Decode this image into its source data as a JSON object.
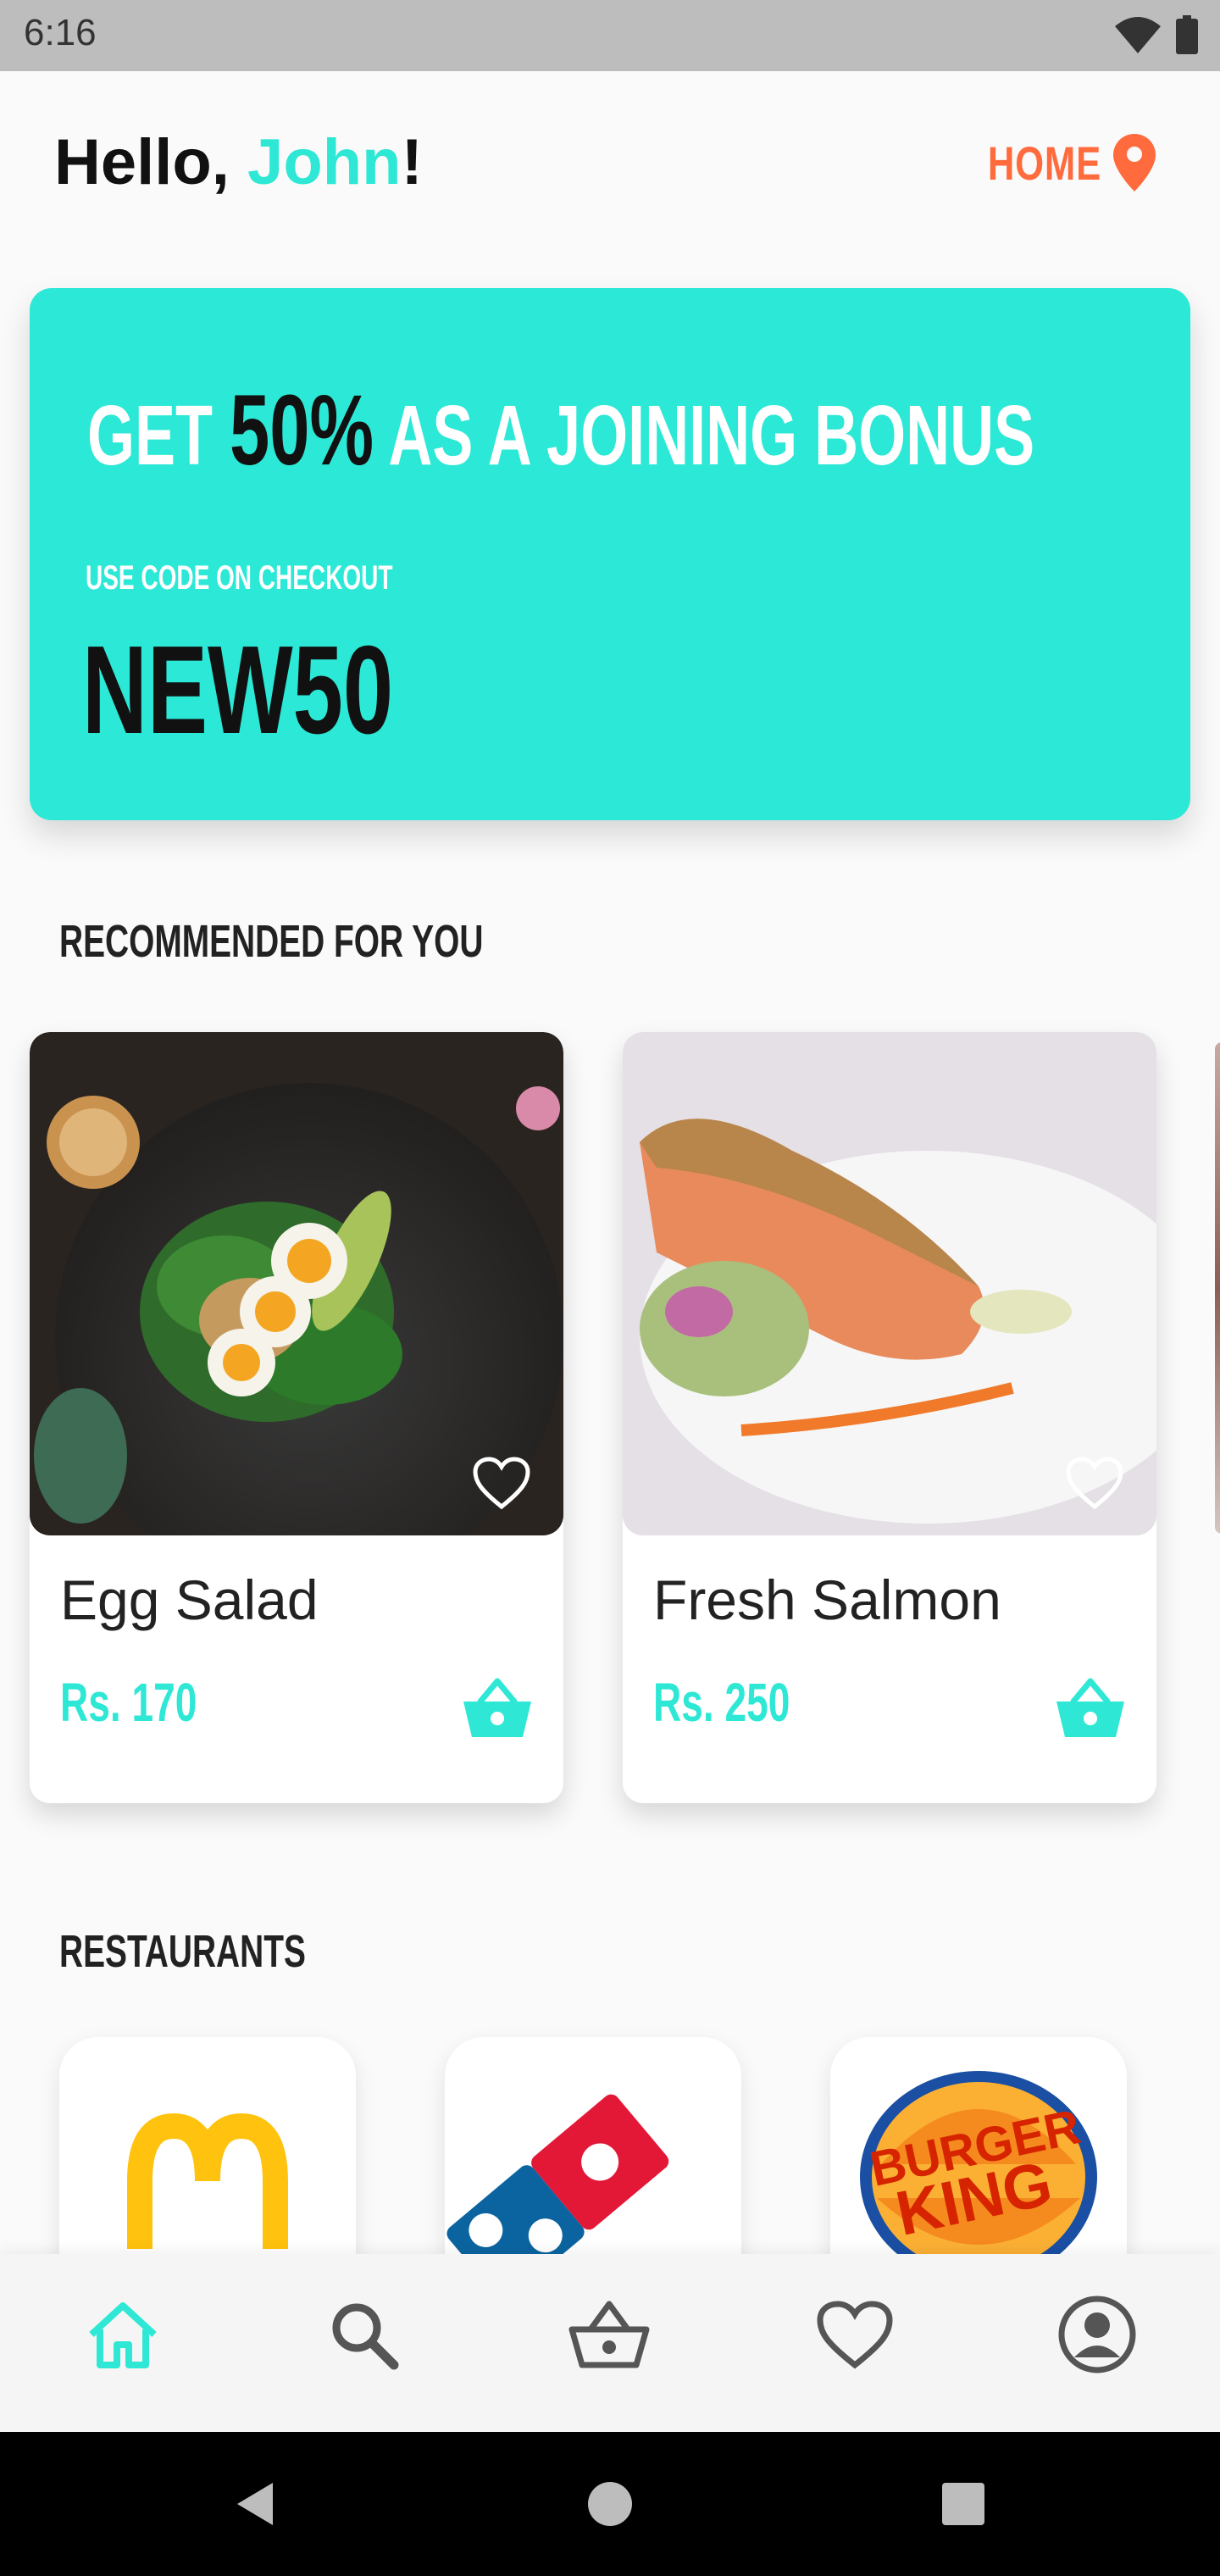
{
  "status_bar": {
    "time": "6:16",
    "icons": [
      "wifi-icon",
      "battery-icon"
    ]
  },
  "header": {
    "greeting_prefix": "Hello, ",
    "user_name": "John",
    "greeting_suffix": "!",
    "location_label": "HOME",
    "location_icon": "location-pin-icon"
  },
  "promo": {
    "headline_prefix": "GET ",
    "headline_percent": "50%",
    "headline_suffix": " AS A JOINING BONUS",
    "subtitle": "USE CODE ON CHECKOUT",
    "code": "NEW50"
  },
  "recommended": {
    "title": "RECOMMENDED FOR YOU",
    "items": [
      {
        "name": "Egg Salad",
        "price": "Rs. 170",
        "favorite_icon": "heart-outline-icon",
        "cart_icon": "basket-icon"
      },
      {
        "name": "Fresh Salmon",
        "price": "Rs. 250",
        "favorite_icon": "heart-outline-icon",
        "cart_icon": "basket-icon"
      }
    ]
  },
  "restaurants": {
    "title": "RESTAURANTS",
    "items": [
      {
        "logo": "mcdonalds-logo"
      },
      {
        "logo": "dominos-logo"
      },
      {
        "logo": "burger-king-logo",
        "logo_text": "BURGER KING"
      }
    ]
  },
  "bottom_nav": {
    "items": [
      {
        "icon": "home-icon",
        "active": true
      },
      {
        "icon": "search-icon",
        "active": false
      },
      {
        "icon": "basket-icon",
        "active": false
      },
      {
        "icon": "heart-icon",
        "active": false
      },
      {
        "icon": "profile-icon",
        "active": false
      }
    ]
  },
  "colors": {
    "accent": "#2ee8d5",
    "location": "#ff6b3d",
    "banner": "#2ce8d6"
  }
}
